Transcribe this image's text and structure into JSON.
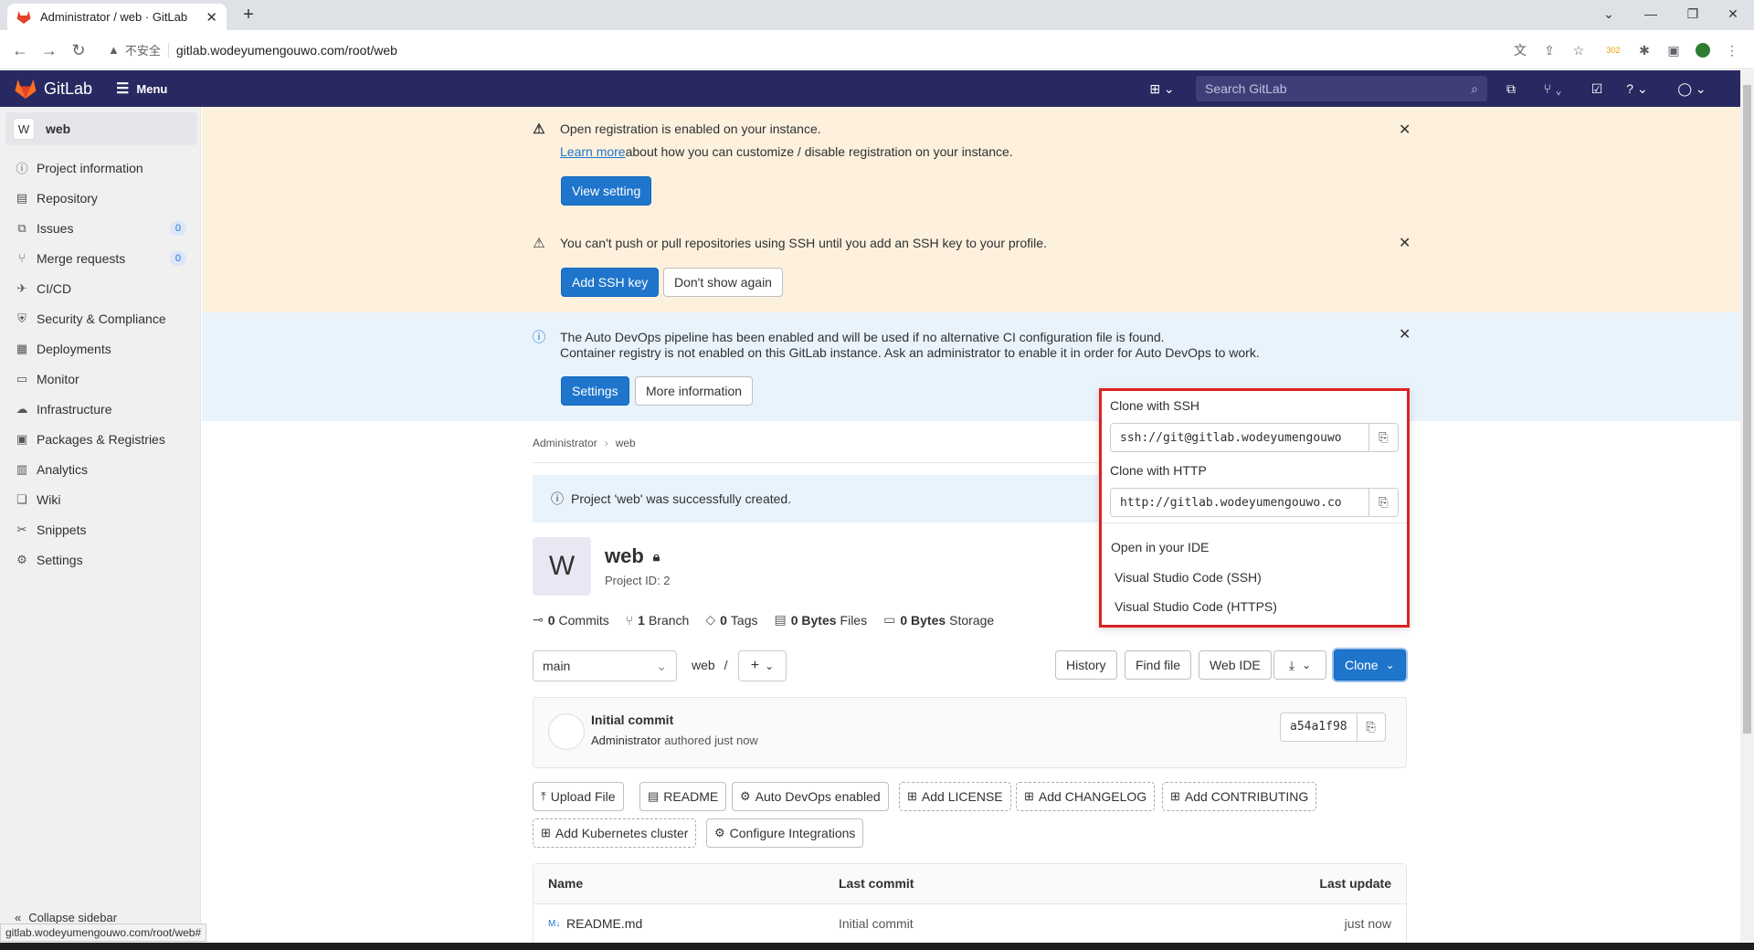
{
  "browser": {
    "tab_title": "Administrator / web · GitLab",
    "security_warning": "不安全",
    "url": "gitlab.wodeyumengouwo.com/root/web",
    "ext_badge": "302",
    "status_url": "gitlab.wodeyumengouwo.com/root/web#"
  },
  "header": {
    "brand": "GitLab",
    "menu": "Menu",
    "search_placeholder": "Search GitLab"
  },
  "sidebar": {
    "project_initial": "W",
    "project_name": "web",
    "items": [
      {
        "label": "Project information",
        "icon": "info-icon"
      },
      {
        "label": "Repository",
        "icon": "doc-icon"
      },
      {
        "label": "Issues",
        "icon": "issues-icon",
        "count": "0"
      },
      {
        "label": "Merge requests",
        "icon": "merge-icon",
        "count": "0"
      },
      {
        "label": "CI/CD",
        "icon": "rocket-icon"
      },
      {
        "label": "Security & Compliance",
        "icon": "shield-icon"
      },
      {
        "label": "Deployments",
        "icon": "deploy-icon"
      },
      {
        "label": "Monitor",
        "icon": "monitor-icon"
      },
      {
        "label": "Infrastructure",
        "icon": "cloud-icon"
      },
      {
        "label": "Packages & Registries",
        "icon": "package-icon"
      },
      {
        "label": "Analytics",
        "icon": "chart-icon"
      },
      {
        "label": "Wiki",
        "icon": "book-icon"
      },
      {
        "label": "Snippets",
        "icon": "scissors-icon"
      },
      {
        "label": "Settings",
        "icon": "gear-icon"
      }
    ],
    "collapse": "Collapse sidebar"
  },
  "banners": {
    "registration_title": "Open registration is enabled on your instance.",
    "registration_link": "Learn more",
    "registration_text": " about how you can customize / disable registration on your instance.",
    "view_setting": "View setting",
    "ssh_text": "You can't push or pull repositories using SSH until you add an SSH key to your profile.",
    "add_ssh_key": "Add SSH key",
    "dont_show": "Don't show again",
    "devops_line1": "The Auto DevOps pipeline has been enabled and will be used if no alternative CI configuration file is found.",
    "devops_line2": "Container registry is not enabled on this GitLab instance. Ask an administrator to enable it in order for Auto DevOps to work.",
    "settings": "Settings",
    "more_info": "More information"
  },
  "breadcrumb": [
    "Administrator",
    "web"
  ],
  "alert": "Project 'web' was successfully created.",
  "project": {
    "initial": "W",
    "name": "web",
    "id_label": "Project ID: 2"
  },
  "stats": {
    "commits_n": "0",
    "commits": "Commits",
    "branch_n": "1",
    "branch": "Branch",
    "tags_n": "0",
    "tags": "Tags",
    "files_n": "0 Bytes",
    "files": "Files",
    "storage_n": "0 Bytes",
    "storage": "Storage"
  },
  "repo_toolbar": {
    "branch": "main",
    "path": "web",
    "path_sep": "/",
    "history": "History",
    "find_file": "Find file",
    "web_ide": "Web IDE",
    "clone": "Clone"
  },
  "commit": {
    "message": "Initial commit",
    "author": "Administrator",
    "authored": " authored just now",
    "sha": "a54a1f98"
  },
  "quick_actions": [
    {
      "label": "Upload File",
      "icon": "upload-icon"
    },
    {
      "label": "README",
      "icon": "doc-icon"
    },
    {
      "label": "Auto DevOps enabled",
      "icon": "gear-icon"
    },
    {
      "label": "Add LICENSE",
      "icon": "plus-square-icon"
    },
    {
      "label": "Add CHANGELOG",
      "icon": "plus-square-icon"
    },
    {
      "label": "Add CONTRIBUTING",
      "icon": "plus-square-icon"
    },
    {
      "label": "Add Kubernetes cluster",
      "icon": "plus-square-icon"
    },
    {
      "label": "Configure Integrations",
      "icon": "gear-icon"
    }
  ],
  "file_table": {
    "col_name": "Name",
    "col_commit": "Last commit",
    "col_update": "Last update",
    "rows": [
      {
        "name": "README.md",
        "commit": "Initial commit",
        "update": "just now"
      }
    ]
  },
  "clone_dropdown": {
    "ssh_title": "Clone with SSH",
    "ssh_url": "ssh://git@gitlab.wodeyumengouwo",
    "http_title": "Clone with HTTP",
    "http_url": "http://gitlab.wodeyumengouwo.co",
    "ide_title": "Open in your IDE",
    "ide_ssh": "Visual Studio Code (SSH)",
    "ide_https": "Visual Studio Code (HTTPS)"
  },
  "colors": {
    "header_bg": "#292961",
    "primary_blue": "#1f75cb",
    "warning_bg": "#fdf1dd",
    "info_bg": "#e9f3fc",
    "highlight_border": "#e02020"
  }
}
